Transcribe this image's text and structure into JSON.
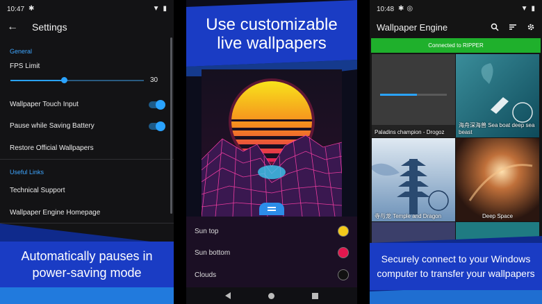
{
  "settings_screen": {
    "status_time": "10:47",
    "title": "Settings",
    "general_header": "General",
    "fps_label": "FPS Limit",
    "fps_value": "30",
    "fps_fraction": 0.4,
    "touch_input_label": "Wallpaper Touch Input",
    "pause_battery_label": "Pause while Saving Battery",
    "restore_label": "Restore Official Wallpapers",
    "useful_links_header": "Useful Links",
    "support_label": "Technical Support",
    "homepage_label": "Wallpaper Engine Homepage",
    "caption_line1": "Automatically pauses in",
    "caption_line2": "power-saving mode"
  },
  "customize_screen": {
    "headline_line1": "Use customizable",
    "headline_line2": "live wallpapers",
    "colors": [
      {
        "label": "Sun top",
        "color": "#f3c91a"
      },
      {
        "label": "Sun bottom",
        "color": "#e3174f"
      },
      {
        "label": "Clouds",
        "color": "#111111"
      }
    ]
  },
  "browser_screen": {
    "status_time": "10:48",
    "title": "Wallpaper Engine",
    "connection_status": "Connected to RIPPER",
    "wallpapers": [
      {
        "title": "Paladins champion - Drogoz"
      },
      {
        "title": "海舟深海兽 Sea boat deep sea beast"
      },
      {
        "title": "寺与龙 Temple and Dragon"
      },
      {
        "title": "Deep Space"
      }
    ],
    "caption_line1": "Securely connect to your Windows",
    "caption_line2": "computer to transfer your wallpapers"
  },
  "colors": {
    "accent_blue": "#2aa3ff",
    "connected_green": "#1fb02c",
    "banner_blue": "#1a3cc4"
  }
}
